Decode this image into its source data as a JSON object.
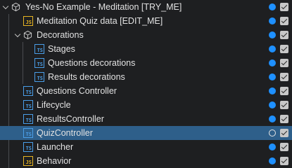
{
  "tree": {
    "root": {
      "label": "Yes-No Example - Meditation  [TRY_ME]",
      "icon": "cube-icon",
      "expanded": true,
      "visible": true,
      "enabled": true
    },
    "items": [
      {
        "label": "Meditation Quiz data [EDIT_ME]",
        "icon": "js-file-icon",
        "icon_text": "JS",
        "visible": true,
        "enabled": true
      },
      {
        "label": "Decorations",
        "icon": "cube-icon",
        "expanded": true,
        "visible": true,
        "enabled": true
      },
      {
        "label": "Stages",
        "icon": "ts-file-icon",
        "icon_text": "TS",
        "visible": true,
        "enabled": true
      },
      {
        "label": "Questions decorations",
        "icon": "ts-file-icon",
        "icon_text": "TS",
        "visible": true,
        "enabled": true
      },
      {
        "label": "Results decorations",
        "icon": "ts-file-icon",
        "icon_text": "TS",
        "visible": true,
        "enabled": true
      },
      {
        "label": "Questions Controller",
        "icon": "ts-file-icon",
        "icon_text": "TS",
        "visible": true,
        "enabled": true
      },
      {
        "label": "Lifecycle",
        "icon": "ts-file-icon",
        "icon_text": "TS",
        "visible": true,
        "enabled": true
      },
      {
        "label": "ResultsController",
        "icon": "ts-file-icon",
        "icon_text": "TS",
        "visible": true,
        "enabled": true
      },
      {
        "label": "QuizController",
        "icon": "ts-file-icon",
        "icon_text": "TS",
        "selected": true,
        "visible": false,
        "enabled": true
      },
      {
        "label": "Launcher",
        "icon": "ts-file-icon",
        "icon_text": "TS",
        "visible": true,
        "enabled": true
      },
      {
        "label": "Behavior",
        "icon": "js-file-icon",
        "icon_text": "JS",
        "visible": true,
        "enabled": true
      }
    ]
  },
  "colors": {
    "background": "#1e1f21",
    "selection": "#2e5f8a",
    "visibility_dot": "#1e90ff",
    "ts_icon": "#4a9ee8",
    "js_icon": "#e6b422"
  }
}
